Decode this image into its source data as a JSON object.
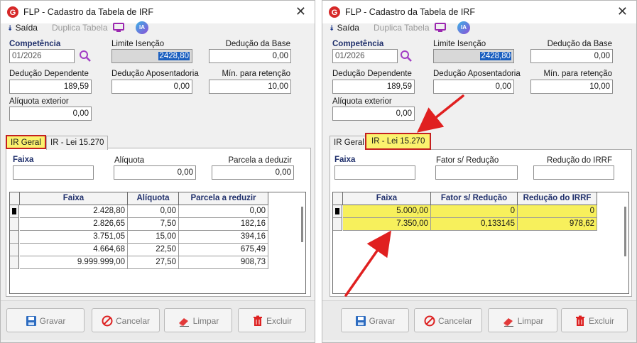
{
  "window": {
    "title": "FLP - Cadastro da Tabela de IRF",
    "close_glyph": "✕"
  },
  "toolbar": {
    "exit_label": "Saída",
    "duplicate_label": "Duplica Tabela",
    "ia_label": "IA"
  },
  "form": {
    "competencia_label": "Competência",
    "competencia_value": "01/2026",
    "limite_label": "Limite Isenção",
    "limite_value": "2428,80",
    "deducao_base_label": "Dedução da Base",
    "deducao_base_value": "0,00",
    "deducao_dep_label": "Dedução Dependente",
    "deducao_dep_value": "189,59",
    "deducao_apos_label": "Dedução Aposentadoria",
    "deducao_apos_value": "0,00",
    "min_ret_label": "Mín. para retenção",
    "min_ret_value": "10,00",
    "aliquota_ext_label": "Alíquota exterior",
    "aliquota_ext_value": "0,00"
  },
  "tabs": {
    "geral": "IR Geral",
    "lei": "IR - Lei 15.270"
  },
  "left_panel": {
    "faixa_label": "Faixa",
    "faixa_value": "",
    "aliquota_label": "Alíquota",
    "aliquota_value": "0,00",
    "parcela_label": "Parcela a deduzir",
    "parcela_value": "0,00",
    "columns": [
      "Faixa",
      "Alíquota",
      "Parcela a reduzir"
    ],
    "rows": [
      [
        "2.428,80",
        "0,00",
        "0,00"
      ],
      [
        "2.826,65",
        "7,50",
        "182,16"
      ],
      [
        "3.751,05",
        "15,00",
        "394,16"
      ],
      [
        "4.664,68",
        "22,50",
        "675,49"
      ],
      [
        "9.999.999,00",
        "27,50",
        "908,73"
      ]
    ]
  },
  "right_panel": {
    "faixa_label": "Faixa",
    "faixa_value": "",
    "fator_label": "Fator s/ Redução",
    "fator_value": "",
    "reducao_label": "Redução do IRRF",
    "reducao_value": "",
    "columns": [
      "Faixa",
      "Fator s/ Redução",
      "Redução do IRRF"
    ],
    "rows": [
      [
        "5.000,00",
        "0",
        "0"
      ],
      [
        "7.350,00",
        "0,133145",
        "978,62"
      ]
    ]
  },
  "buttons": {
    "gravar": "Gravar",
    "cancelar": "Cancelar",
    "limpar": "Limpar",
    "excluir": "Excluir"
  },
  "colors": {
    "highlight_yellow": "#f7f05c",
    "annotation_red": "#c42020",
    "label_blue": "#1f2f6b",
    "selection_blue": "#1b5fbf"
  },
  "icons": [
    "app-logo-icon",
    "close-icon",
    "exit-arrow-icon",
    "monitor-icon",
    "ia-icon",
    "search-icon",
    "save-icon",
    "cancel-icon",
    "eraser-icon",
    "trash-icon"
  ]
}
